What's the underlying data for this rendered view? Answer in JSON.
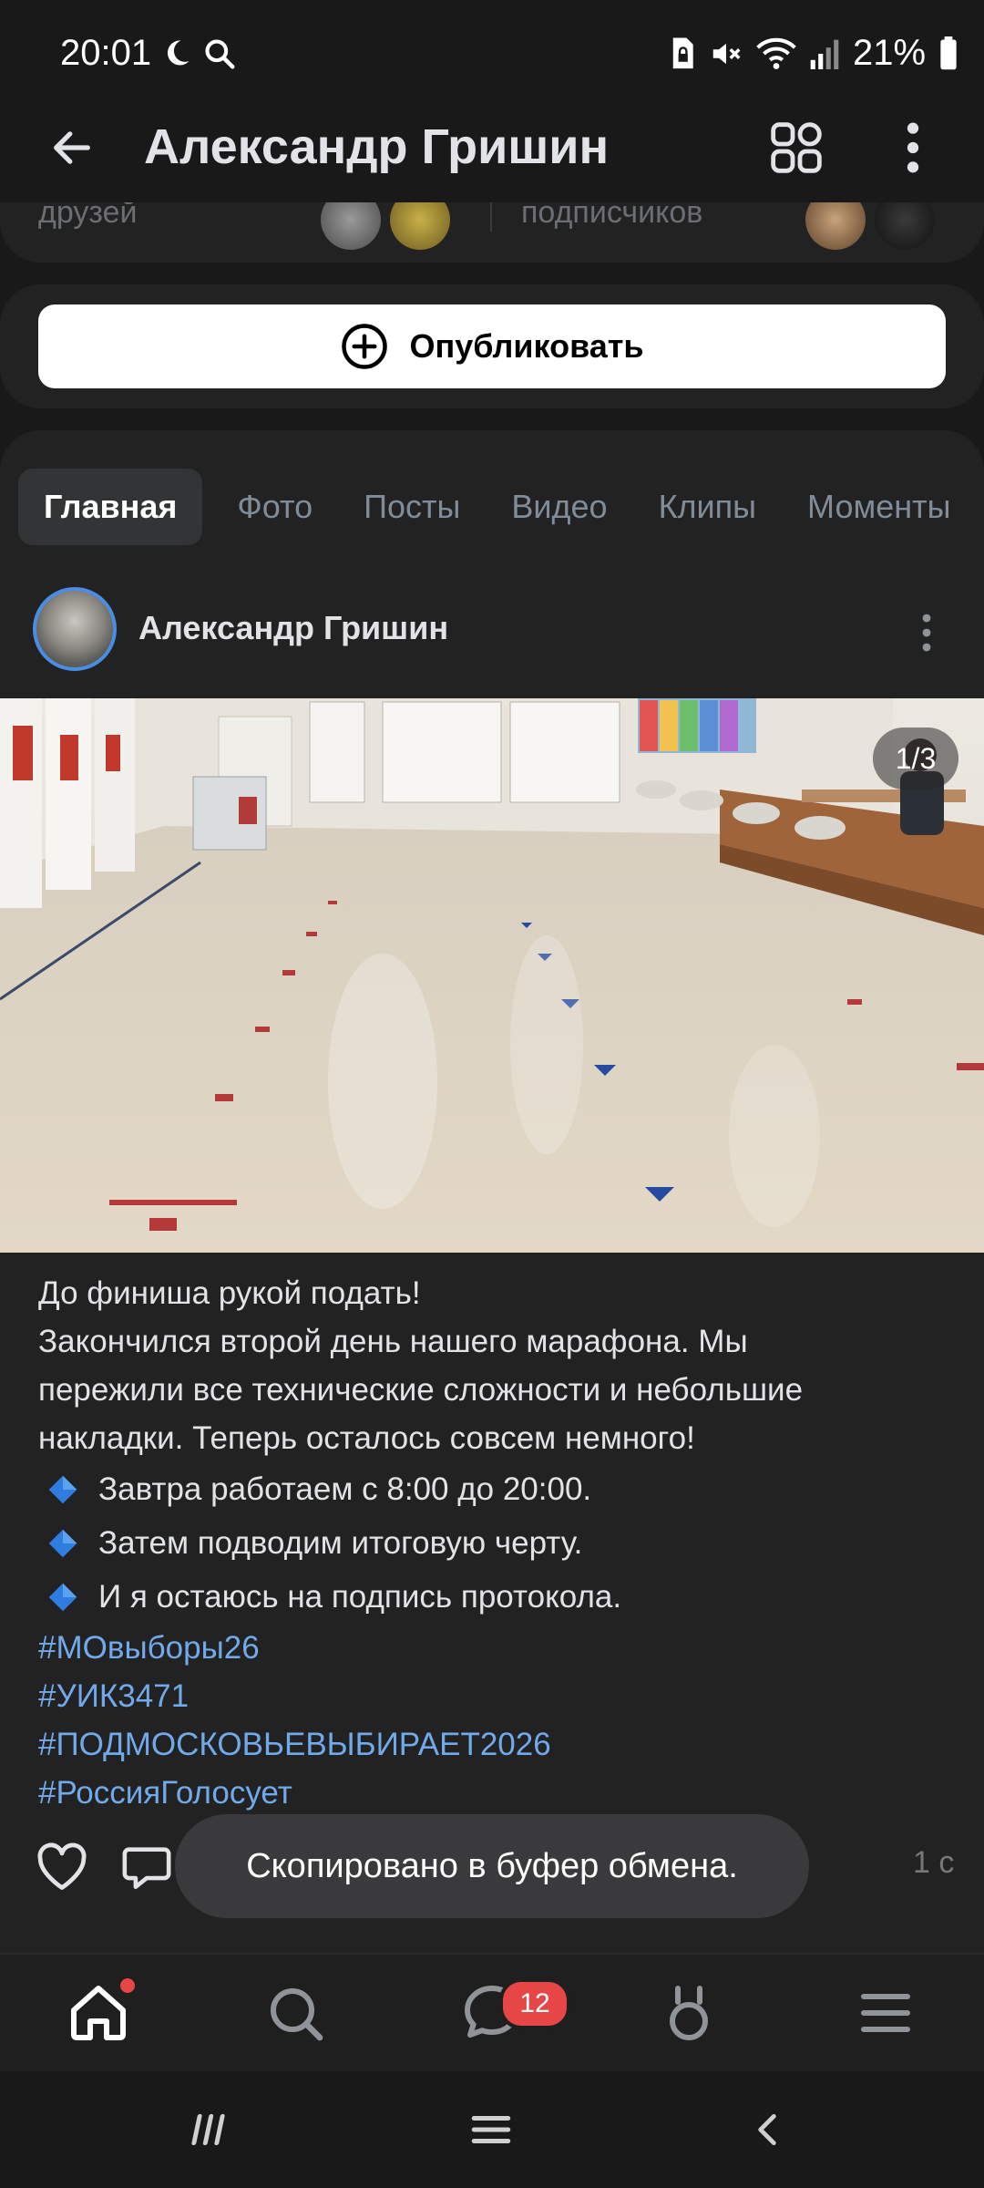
{
  "status_bar": {
    "time": "20:01",
    "battery": "21%",
    "icons": [
      "moon-icon",
      "search-icon",
      "sim-lock-icon",
      "mute-icon",
      "wifi-icon",
      "signal-icon",
      "battery-icon"
    ]
  },
  "header": {
    "title": "Александр Гришин",
    "back_icon": "arrow-left-icon",
    "qr_icon": "qr-code-icon",
    "more_icon": "more-vertical-icon"
  },
  "profile_card": {
    "friends_label": "друзей",
    "followers_label": "подписчиков"
  },
  "publish": {
    "label": "Опубликовать",
    "icon": "plus-circle-icon"
  },
  "tabs": [
    {
      "label": "Главная",
      "active": true
    },
    {
      "label": "Фото",
      "active": false
    },
    {
      "label": "Посты",
      "active": false
    },
    {
      "label": "Видео",
      "active": false
    },
    {
      "label": "Клипы",
      "active": false
    },
    {
      "label": "Моменты",
      "active": false
    }
  ],
  "post": {
    "author": "Александр Гришин",
    "photo_counter": "1/3",
    "text_lines": [
      "До финиша рукой подать!",
      "Закончился второй день нашего марафона. Мы",
      "пережили все технические сложности и небольшие",
      "накладки. Теперь осталось совсем немного!"
    ],
    "bullets": [
      "Завтра работаем с 8:00 до 20:00.",
      "Затем подводим итоговую черту.",
      "И я остаюсь на подпись протокола."
    ],
    "hashtags": [
      "#МОвыборы26",
      "#УИК3471",
      "#ПОДМОСКОВЬЕВЫБИРАЕТ2026",
      "#РоссияГолосует"
    ],
    "time_ago": "1 с"
  },
  "toast": {
    "message": "Скопировано в буфер обмена."
  },
  "bottom_nav": {
    "items": [
      "home-icon",
      "search-icon",
      "messages-icon",
      "services-icon",
      "menu-icon"
    ],
    "messages_badge": "12"
  },
  "colors": {
    "background": "#19191a",
    "card": "#222222",
    "accent_link": "#71aaeb",
    "badge": "#e64646"
  }
}
